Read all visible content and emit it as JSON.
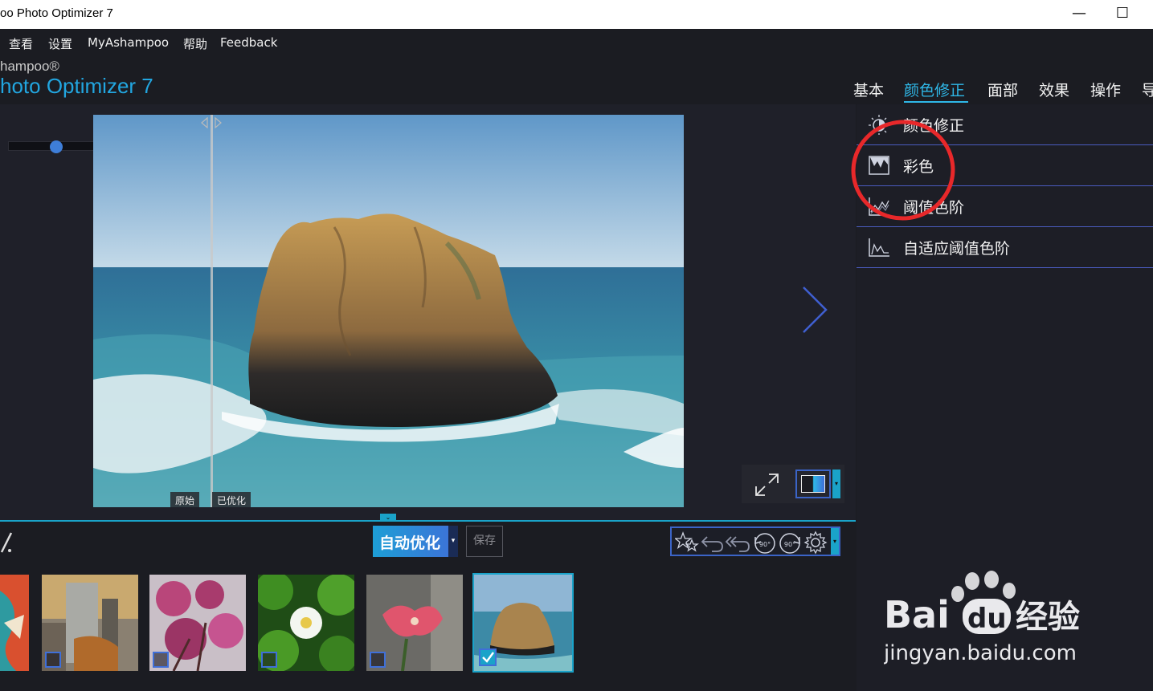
{
  "window": {
    "title": "oo Photo Optimizer 7",
    "maximize_glyph": "☐",
    "minimize_glyph": "—"
  },
  "menu": [
    "查看",
    "设置",
    "MyAshampoo",
    "帮助",
    "Feedback"
  ],
  "brand": {
    "line1": "hampoo®",
    "line2": "hoto Optimizer 7"
  },
  "tabs": [
    "基本",
    "颜色修正",
    "面部",
    "效果",
    "操作",
    "导"
  ],
  "active_tab": "颜色修正",
  "right_panel": {
    "items": [
      {
        "label": "颜色修正",
        "icon": "brightness-icon"
      },
      {
        "label": "彩色",
        "icon": "color-levels-icon"
      },
      {
        "label": "阈值色阶",
        "icon": "threshold-icon"
      },
      {
        "label": "自适应阈值色阶",
        "icon": "adaptive-threshold-icon"
      }
    ]
  },
  "zoom": {
    "minus": "−",
    "plus": "+"
  },
  "compare": {
    "original": "原始",
    "optimized": "已优化"
  },
  "actions": {
    "auto_optimize": "自动优化",
    "save": "保存",
    "dropdown": "▾"
  },
  "toolbox_icons": [
    "stars-icon",
    "undo-icon",
    "undo-all-icon",
    "rotate-left-90-icon",
    "rotate-right-90-icon",
    "settings-icon"
  ],
  "toolbox_labels": {
    "rotate_left": "90°",
    "rotate_right": "90°"
  },
  "thumbnails": [
    {
      "subject": "abstract-art",
      "checked": false
    },
    {
      "subject": "city-buildings",
      "checked": false
    },
    {
      "subject": "pink-blossoms",
      "checked": false
    },
    {
      "subject": "white-flower-leaves",
      "checked": false
    },
    {
      "subject": "pink-flower",
      "checked": false
    },
    {
      "subject": "rock-in-sea",
      "checked": true,
      "selected": true
    }
  ],
  "watermark": {
    "brand": "Bai",
    "brand2": "du",
    "brand3": "经验",
    "url": "jingyan.baidu.com"
  },
  "colors": {
    "accent": "#2fb8e8",
    "annotation_circle": "#e8282a",
    "panel_divider": "#4b5cc0"
  }
}
